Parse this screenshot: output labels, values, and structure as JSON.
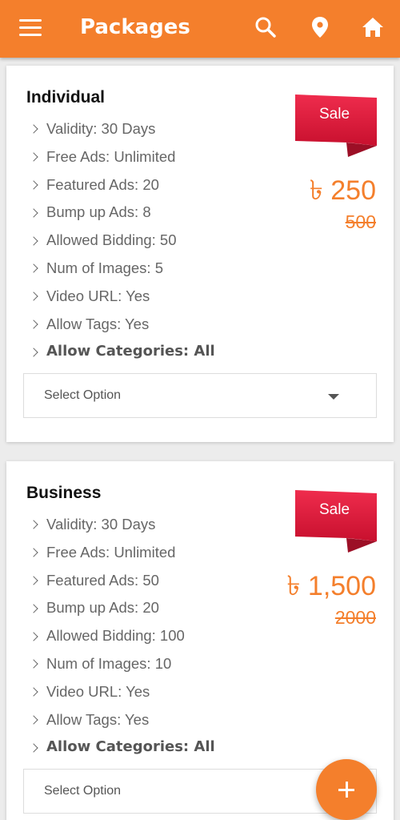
{
  "appbar": {
    "title": "Packages",
    "icons": [
      "menu-icon",
      "search-icon",
      "location-pin-icon",
      "home-icon"
    ]
  },
  "colors": {
    "primary": "#f47f2c",
    "sale_badge": "#d81b3b"
  },
  "packages": [
    {
      "name": "Individual",
      "sale_label": "Sale",
      "price": "৳ 250",
      "old_price": "500",
      "features": [
        "Validity: 30 Days",
        "Free Ads: Unlimited",
        "Featured Ads: 20",
        "Bump up Ads: 8",
        "Allowed Bidding: 50",
        "Num of Images: 5",
        "Video URL: Yes",
        "Allow Tags: Yes",
        "Allow Categories: All"
      ],
      "select_placeholder": "Select Option"
    },
    {
      "name": "Business",
      "sale_label": "Sale",
      "price": "৳ 1,500",
      "old_price": "2000",
      "features": [
        "Validity: 30 Days",
        "Free Ads: Unlimited",
        "Featured Ads: 50",
        "Bump up Ads: 20",
        "Allowed Bidding: 100",
        "Num of Images: 10",
        "Video URL: Yes",
        "Allow Tags: Yes",
        "Allow Categories: All"
      ],
      "select_placeholder": "Select Option"
    }
  ]
}
